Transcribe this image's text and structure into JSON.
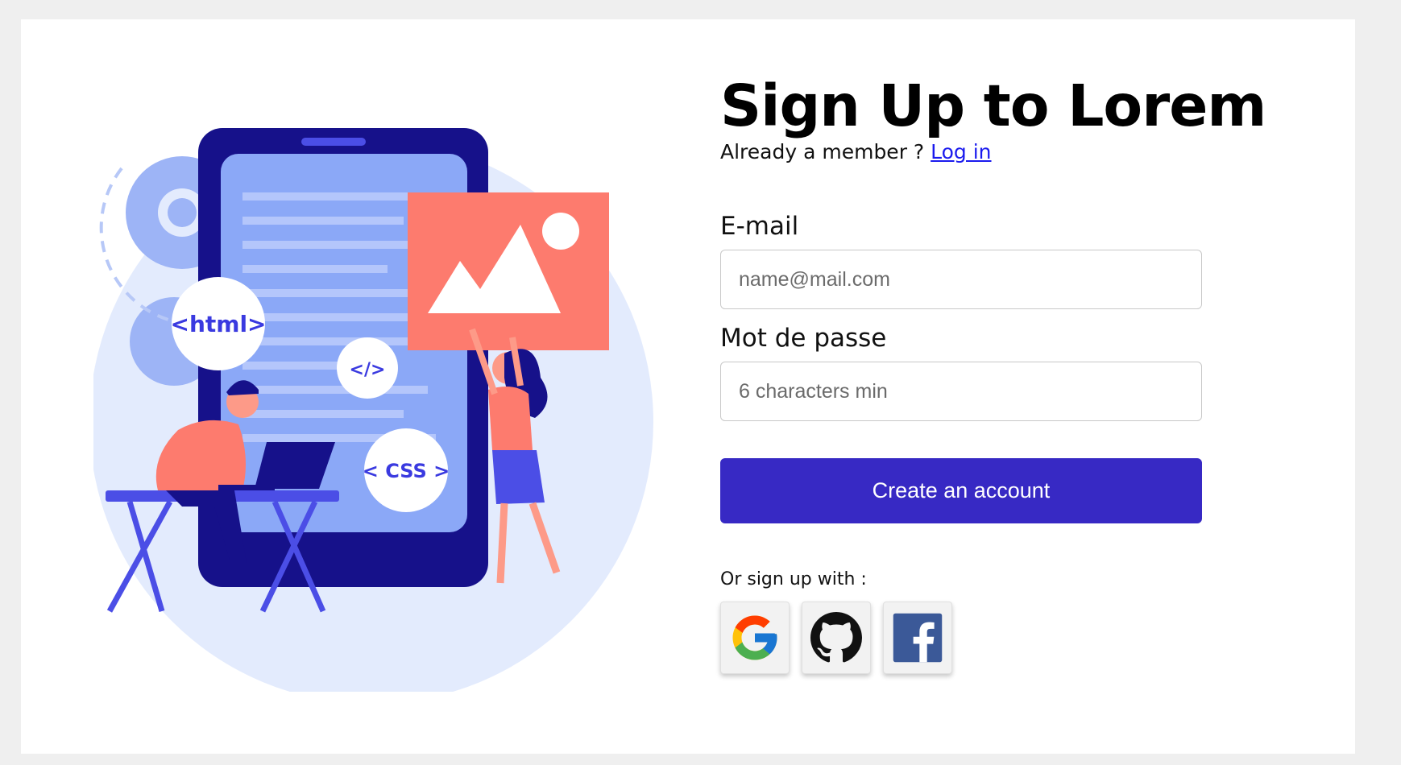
{
  "heading": {
    "title": "Sign Up to Lorem"
  },
  "member": {
    "prompt": "Already a member ?",
    "login_link": "Log in"
  },
  "illustration_tags": {
    "html": "<html>",
    "code": "</>",
    "css": "< CSS >"
  },
  "form": {
    "email": {
      "label": "E-mail",
      "placeholder": "name@mail.com",
      "value": ""
    },
    "password": {
      "label": "Mot de passe",
      "placeholder": "6 characters min",
      "value": ""
    },
    "submit_label": "Create an account"
  },
  "social": {
    "prompt": "Or sign up with :",
    "providers": [
      {
        "name": "Google",
        "icon": "google-icon"
      },
      {
        "name": "GitHub",
        "icon": "github-icon"
      },
      {
        "name": "Facebook",
        "icon": "facebook-icon"
      }
    ]
  },
  "colors": {
    "primary": "#3729c4",
    "page_background": "#efefef",
    "card_background": "#ffffff",
    "link": "#1a1aee",
    "illustration_navy": "#16118a",
    "illustration_blue": "#8ba8f7",
    "illustration_coral": "#fd7b6e"
  }
}
